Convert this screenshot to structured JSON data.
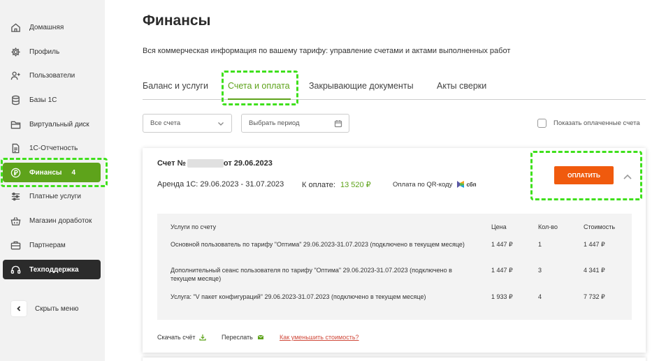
{
  "sidebar": {
    "items": [
      {
        "label": "Домашняя",
        "icon": "home-icon"
      },
      {
        "label": "Профиль",
        "icon": "gear-icon"
      },
      {
        "label": "Пользователи",
        "icon": "add-user-icon"
      },
      {
        "label": "Базы 1С",
        "icon": "database-icon"
      },
      {
        "label": "Виртуальный диск",
        "icon": "folder-icon"
      },
      {
        "label": "1С-Отчетность",
        "icon": "document-icon"
      },
      {
        "label": "Финансы",
        "icon": "ruble-coin-icon",
        "badge": "4"
      },
      {
        "label": "Платные услуги",
        "icon": "sliders-icon"
      },
      {
        "label": "Магазин доработок",
        "icon": "basket-icon"
      },
      {
        "label": "Партнерам",
        "icon": "briefcase-icon"
      },
      {
        "label": "Техподдержка",
        "icon": "headset-icon"
      }
    ],
    "hide_menu": "Скрыть меню"
  },
  "main": {
    "title": "Финансы",
    "subtitle": "Вся коммерческая информация по вашему тарифу: управление счетами и актами выполненных работ",
    "tabs": [
      "Баланс и услуги",
      "Счета и оплата",
      "Закрывающие документы",
      "Акты сверки"
    ],
    "active_tab": "Счета и оплата",
    "filters": {
      "accounts": "Все счета",
      "period": "Выбрать период",
      "show_paid": "Показать оплаченные счета"
    }
  },
  "invoice": {
    "title_prefix": "Счет №",
    "title_suffix": "от 29.06.2023",
    "period": "Аренда 1С: 29.06.2023 - 31.07.2023",
    "amount_label": "К оплате:",
    "amount_value": "13 520 ₽",
    "qr_label": "Оплата по QR-коду",
    "sbp_label": "сбп",
    "pay_button": "ОПЛАТИТЬ",
    "table": {
      "headers": [
        "Услуги по счету",
        "Цена",
        "Кол-во",
        "Стоимость"
      ],
      "rows": [
        {
          "service": "Основной пользователь по тарифу \"Оптима\" 29.06.2023-31.07.2023 (подключено в текущем месяце)",
          "price": "1 447 ₽",
          "qty": "1",
          "total": "1 447 ₽"
        },
        {
          "service": "Дополнительный сеанс пользователя по тарифу \"Оптима\" 29.06.2023-31.07.2023 (подключено в текущем месяце)",
          "price": "1 447 ₽",
          "qty": "3",
          "total": "4 341 ₽"
        },
        {
          "service": "Услуга: \"V пакет конфигураций\" 29.06.2023-31.07.2023 (подключено в текущем месяце)",
          "price": "1 933 ₽",
          "qty": "4",
          "total": "7 732 ₽"
        }
      ]
    },
    "download": "Скачать счёт",
    "forward": "Переслать",
    "reduce_cost": "Как уменьшить стоимость?"
  },
  "colors": {
    "accent": "#5ea31b",
    "pay": "#f05a0d",
    "highlight": "#3fe01c",
    "support_bg": "#2b2b2b"
  }
}
